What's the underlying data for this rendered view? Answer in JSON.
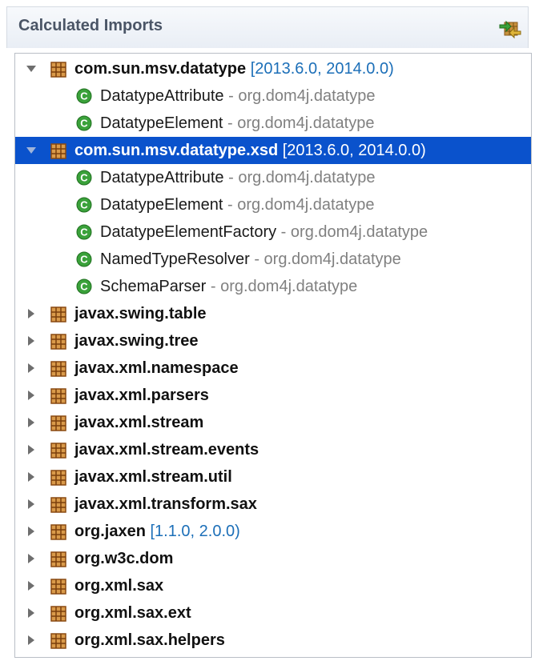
{
  "panel": {
    "title": "Calculated Imports",
    "toolbar_icon": "refresh-imports-icon"
  },
  "tree": {
    "rows": [
      {
        "type": "package",
        "name": "com.sun.msv.datatype",
        "range": "[2013.6.0, 2014.0.0)",
        "expanded": true,
        "selected": false
      },
      {
        "type": "class",
        "name": "DatatypeAttribute",
        "sep": "-",
        "pkg": "org.dom4j.datatype"
      },
      {
        "type": "class",
        "name": "DatatypeElement",
        "sep": "-",
        "pkg": "org.dom4j.datatype"
      },
      {
        "type": "package",
        "name": "com.sun.msv.datatype.xsd",
        "range": "[2013.6.0, 2014.0.0)",
        "expanded": true,
        "selected": true
      },
      {
        "type": "class",
        "name": "DatatypeAttribute",
        "sep": "-",
        "pkg": "org.dom4j.datatype"
      },
      {
        "type": "class",
        "name": "DatatypeElement",
        "sep": "-",
        "pkg": "org.dom4j.datatype"
      },
      {
        "type": "class",
        "name": "DatatypeElementFactory",
        "sep": "-",
        "pkg": "org.dom4j.datatype"
      },
      {
        "type": "class",
        "name": "NamedTypeResolver",
        "sep": "-",
        "pkg": "org.dom4j.datatype"
      },
      {
        "type": "class",
        "name": "SchemaParser",
        "sep": "-",
        "pkg": "org.dom4j.datatype"
      },
      {
        "type": "package",
        "name": "javax.swing.table",
        "range": "",
        "expanded": false,
        "selected": false
      },
      {
        "type": "package",
        "name": "javax.swing.tree",
        "range": "",
        "expanded": false,
        "selected": false
      },
      {
        "type": "package",
        "name": "javax.xml.namespace",
        "range": "",
        "expanded": false,
        "selected": false
      },
      {
        "type": "package",
        "name": "javax.xml.parsers",
        "range": "",
        "expanded": false,
        "selected": false
      },
      {
        "type": "package",
        "name": "javax.xml.stream",
        "range": "",
        "expanded": false,
        "selected": false
      },
      {
        "type": "package",
        "name": "javax.xml.stream.events",
        "range": "",
        "expanded": false,
        "selected": false
      },
      {
        "type": "package",
        "name": "javax.xml.stream.util",
        "range": "",
        "expanded": false,
        "selected": false
      },
      {
        "type": "package",
        "name": "javax.xml.transform.sax",
        "range": "",
        "expanded": false,
        "selected": false
      },
      {
        "type": "package",
        "name": "org.jaxen",
        "range": "[1.1.0, 2.0.0)",
        "expanded": false,
        "selected": false
      },
      {
        "type": "package",
        "name": "org.w3c.dom",
        "range": "",
        "expanded": false,
        "selected": false
      },
      {
        "type": "package",
        "name": "org.xml.sax",
        "range": "",
        "expanded": false,
        "selected": false
      },
      {
        "type": "package",
        "name": "org.xml.sax.ext",
        "range": "",
        "expanded": false,
        "selected": false
      },
      {
        "type": "package",
        "name": "org.xml.sax.helpers",
        "range": "",
        "expanded": false,
        "selected": false
      }
    ]
  },
  "colors": {
    "selection": "#0a52cc",
    "range_text": "#1c6fb8",
    "package_icon": "#b5651d",
    "class_icon": "#3aa13a"
  }
}
